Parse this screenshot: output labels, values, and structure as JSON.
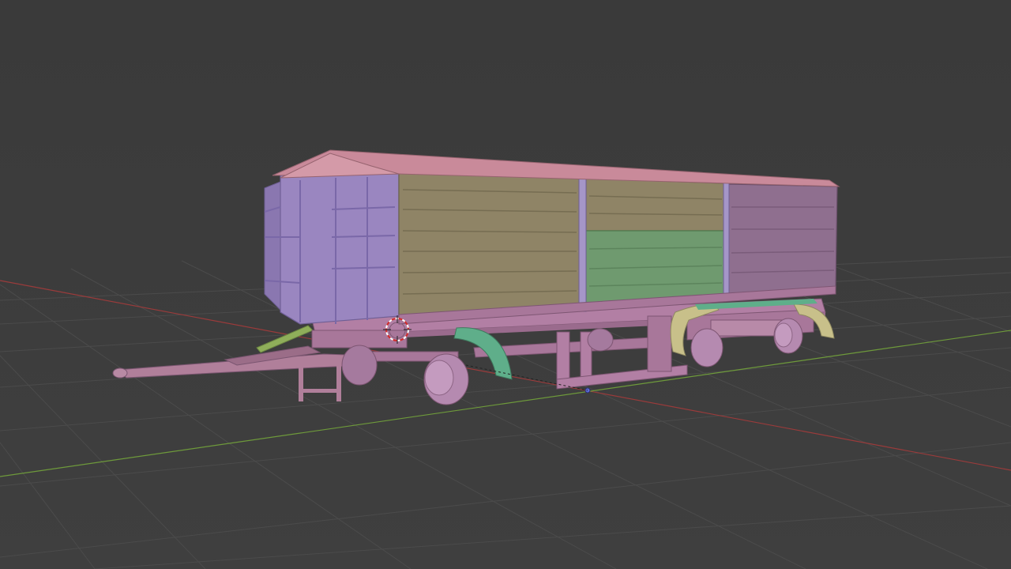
{
  "viewport": {
    "type": "3d-viewport",
    "shading": "solid",
    "background_color": "#3c3c3c",
    "grid_color": "#4a4a4a",
    "x_axis_color": "#9a3b3b",
    "y_axis_color": "#6e9a3b"
  },
  "scene": {
    "object": "farm-trailer",
    "part_colors": {
      "roof": "#c98a9a",
      "front_wall": "#9a86c0",
      "side_panel_front": "#8f8466",
      "side_panel_middle_top": "#8f8466",
      "side_panel_middle_bottom": "#6f9a6f",
      "side_panel_rear": "#8f6f8f",
      "chassis": "#b27fa4",
      "drawbar": "#b07f9a",
      "front_fender": "#5fae8a",
      "rear_fender": "#c8c08a",
      "wheels": "#b58ab0",
      "spring": "#8fae5a"
    }
  },
  "icons": {
    "cursor": "3d-cursor-icon",
    "origin": "object-origin-icon"
  }
}
